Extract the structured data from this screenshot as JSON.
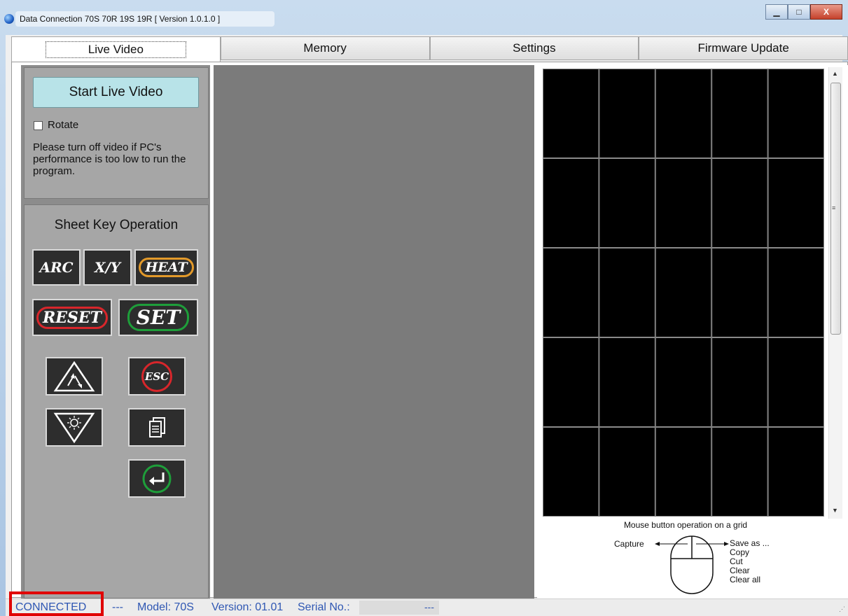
{
  "window": {
    "title": "Data Connection 70S 70R 19S 19R   [ Version 1.0.1.0 ]",
    "controls": {
      "minimize": "▁",
      "maximize": "□",
      "close": "X"
    }
  },
  "tabs": [
    {
      "label": "Live Video",
      "active": true
    },
    {
      "label": "Memory",
      "active": false
    },
    {
      "label": "Settings",
      "active": false
    },
    {
      "label": "Firmware Update",
      "active": false
    }
  ],
  "live_panel": {
    "start_button": "Start Live Video",
    "rotate_label": "Rotate",
    "rotate_checked": false,
    "note": "Please turn off video if PC's performance is too low to run the program."
  },
  "sheet_keys": {
    "title": "Sheet Key Operation",
    "arc": "ARC",
    "xy": "X/Y",
    "heat": "HEAT",
    "reset": "RESET",
    "set": "SET",
    "esc": "ESC",
    "ring_colors": {
      "heat": "#e39a2a",
      "reset": "#d8262b",
      "set": "#1e9e3a",
      "esc": "#d8262b",
      "enter": "#1e9e3a"
    }
  },
  "grid": {
    "rows": 5,
    "cols": 5
  },
  "mouse_help": {
    "title": "Mouse button operation on a grid",
    "left_action": "Capture",
    "right_actions": [
      "Save as ...",
      "Copy",
      "Cut",
      "Clear",
      "Clear all"
    ]
  },
  "status": {
    "connection": "CONNECTED",
    "sep1": "---",
    "model": "Model: 70S",
    "version": "Version: 01.01",
    "serial_label": "Serial No.:",
    "serial_value": "---"
  }
}
